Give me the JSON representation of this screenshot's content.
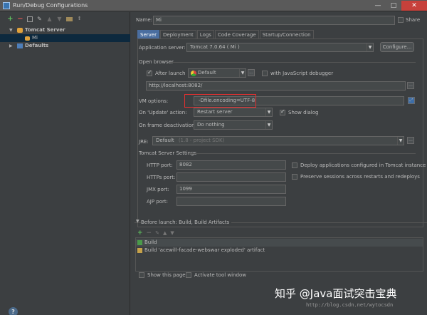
{
  "window": {
    "title": "Run/Debug Configurations",
    "buttons": [
      "—",
      "□",
      "✕"
    ]
  },
  "tree": {
    "toolbar_icons": [
      "add-icon",
      "remove-icon",
      "copy-icon",
      "wrench-icon",
      "move-up-icon",
      "move-down-icon",
      "folder-icon",
      "sort-icon"
    ],
    "root": {
      "label": "Tomcat Server"
    },
    "child": {
      "label": "Mi"
    },
    "defaults": {
      "label": "Defaults"
    }
  },
  "header": {
    "name_label": "Name:",
    "name_value": "Mi",
    "share_label": "Share"
  },
  "tabs": [
    "Server",
    "Deployment",
    "Logs",
    "Code Coverage",
    "Startup/Connection"
  ],
  "server": {
    "app_server_label": "Application server:",
    "app_server_value": "Tomcat 7.0.64 ( Mi )",
    "configure_label": "Configure...",
    "open_browser_label": "Open browser",
    "after_launch_label": "After launch",
    "browser_value": "Default",
    "more_label": "...",
    "js_debugger_label": "with JavaScript debugger",
    "url_value": "http://localhost:8082/",
    "vm_options_label": "VM options:",
    "vm_options_value": "-Dfile.encoding=UTF-8",
    "on_update_label": "On 'Update' action:",
    "on_update_value": "Restart server",
    "show_dialog_label": "Show dialog",
    "on_frame_label": "On frame deactivation:",
    "on_frame_value": "Do nothing",
    "jre_label": "JRE:",
    "jre_value": "Default",
    "jre_hint": "(1.8 - project SDK)",
    "tomcat_settings_label": "Tomcat Server Settings",
    "http_port_label": "HTTP port:",
    "http_port_value": "8082",
    "https_port_label": "HTTPs port:",
    "https_port_value": "",
    "jmx_port_label": "JMX port:",
    "jmx_port_value": "1099",
    "ajp_port_label": "AJP port:",
    "ajp_port_value": "",
    "deploy_label": "Deploy applications configured in Tomcat instance",
    "preserve_label": "Preserve sessions across restarts and redeploys"
  },
  "before_launch": {
    "title": "Before launch: Build, Build Artifacts",
    "items": [
      {
        "label": "Build"
      },
      {
        "label": "Build 'acewill-facade-webswar exploded' artifact"
      }
    ]
  },
  "footer": {
    "show_page_label": "Show this page",
    "activate_tool_label": "Activate tool window"
  },
  "watermark": {
    "main": "知乎 @Java面试突击宝典",
    "sub": "http://blog.csdn.net/wytocsdn"
  },
  "colors": {
    "background": "#3c3f41",
    "selection": "#0d293e",
    "active_tab": "#4a6ea0",
    "highlight_box": "#e03030"
  }
}
